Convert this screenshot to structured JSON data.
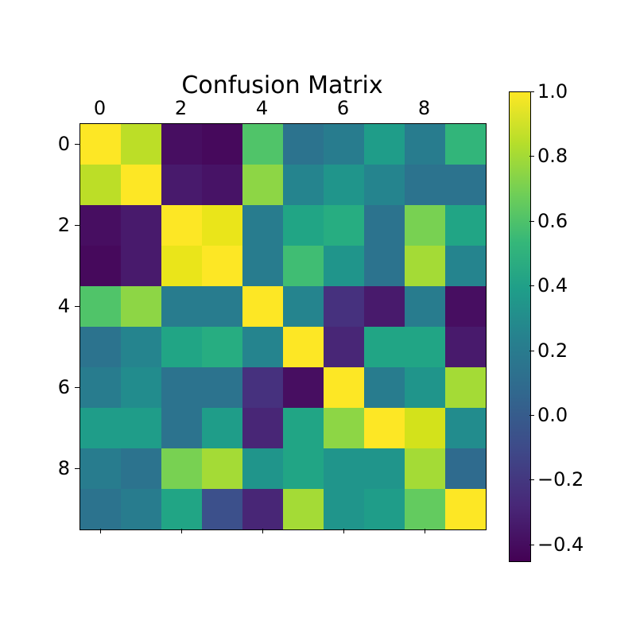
{
  "chart_data": {
    "type": "heatmap",
    "title": "Confusion Matrix",
    "x_ticks": [
      0,
      2,
      4,
      6,
      8
    ],
    "y_ticks": [
      0,
      2,
      4,
      6,
      8
    ],
    "colorbar_ticks": [
      -0.4,
      -0.2,
      0.0,
      0.2,
      0.4,
      0.6,
      0.8,
      1.0
    ],
    "colorbar_labels": [
      "−0.4",
      "−0.2",
      "0.0",
      "0.2",
      "0.4",
      "0.6",
      "0.8",
      "1.0"
    ],
    "vmin": -0.45,
    "vmax": 1.0,
    "colormap": "viridis",
    "data": [
      [
        1.0,
        0.85,
        -0.4,
        -0.42,
        0.6,
        0.1,
        0.15,
        0.35,
        0.15,
        0.5
      ],
      [
        0.85,
        1.0,
        -0.35,
        -0.38,
        0.75,
        0.2,
        0.3,
        0.2,
        0.1,
        0.1
      ],
      [
        -0.4,
        -0.35,
        1.0,
        0.95,
        0.15,
        0.4,
        0.45,
        0.1,
        0.7,
        0.4
      ],
      [
        -0.42,
        -0.35,
        0.95,
        1.0,
        0.15,
        0.55,
        0.3,
        0.1,
        0.8,
        0.2
      ],
      [
        0.6,
        0.75,
        0.15,
        0.15,
        1.0,
        0.2,
        -0.25,
        -0.35,
        0.15,
        -0.4
      ],
      [
        0.1,
        0.2,
        0.4,
        0.45,
        0.2,
        1.0,
        -0.3,
        0.4,
        0.4,
        -0.35
      ],
      [
        0.15,
        0.25,
        0.1,
        0.1,
        -0.25,
        -0.4,
        1.0,
        0.15,
        0.3,
        0.8
      ],
      [
        0.35,
        0.35,
        0.1,
        0.35,
        -0.3,
        0.4,
        0.75,
        1.0,
        0.9,
        0.25
      ],
      [
        0.15,
        0.1,
        0.7,
        0.8,
        0.3,
        0.4,
        0.3,
        0.3,
        0.8,
        0.05
      ],
      [
        0.1,
        0.15,
        0.4,
        -0.1,
        -0.3,
        0.8,
        0.3,
        0.35,
        0.65,
        1.0
      ]
    ]
  }
}
